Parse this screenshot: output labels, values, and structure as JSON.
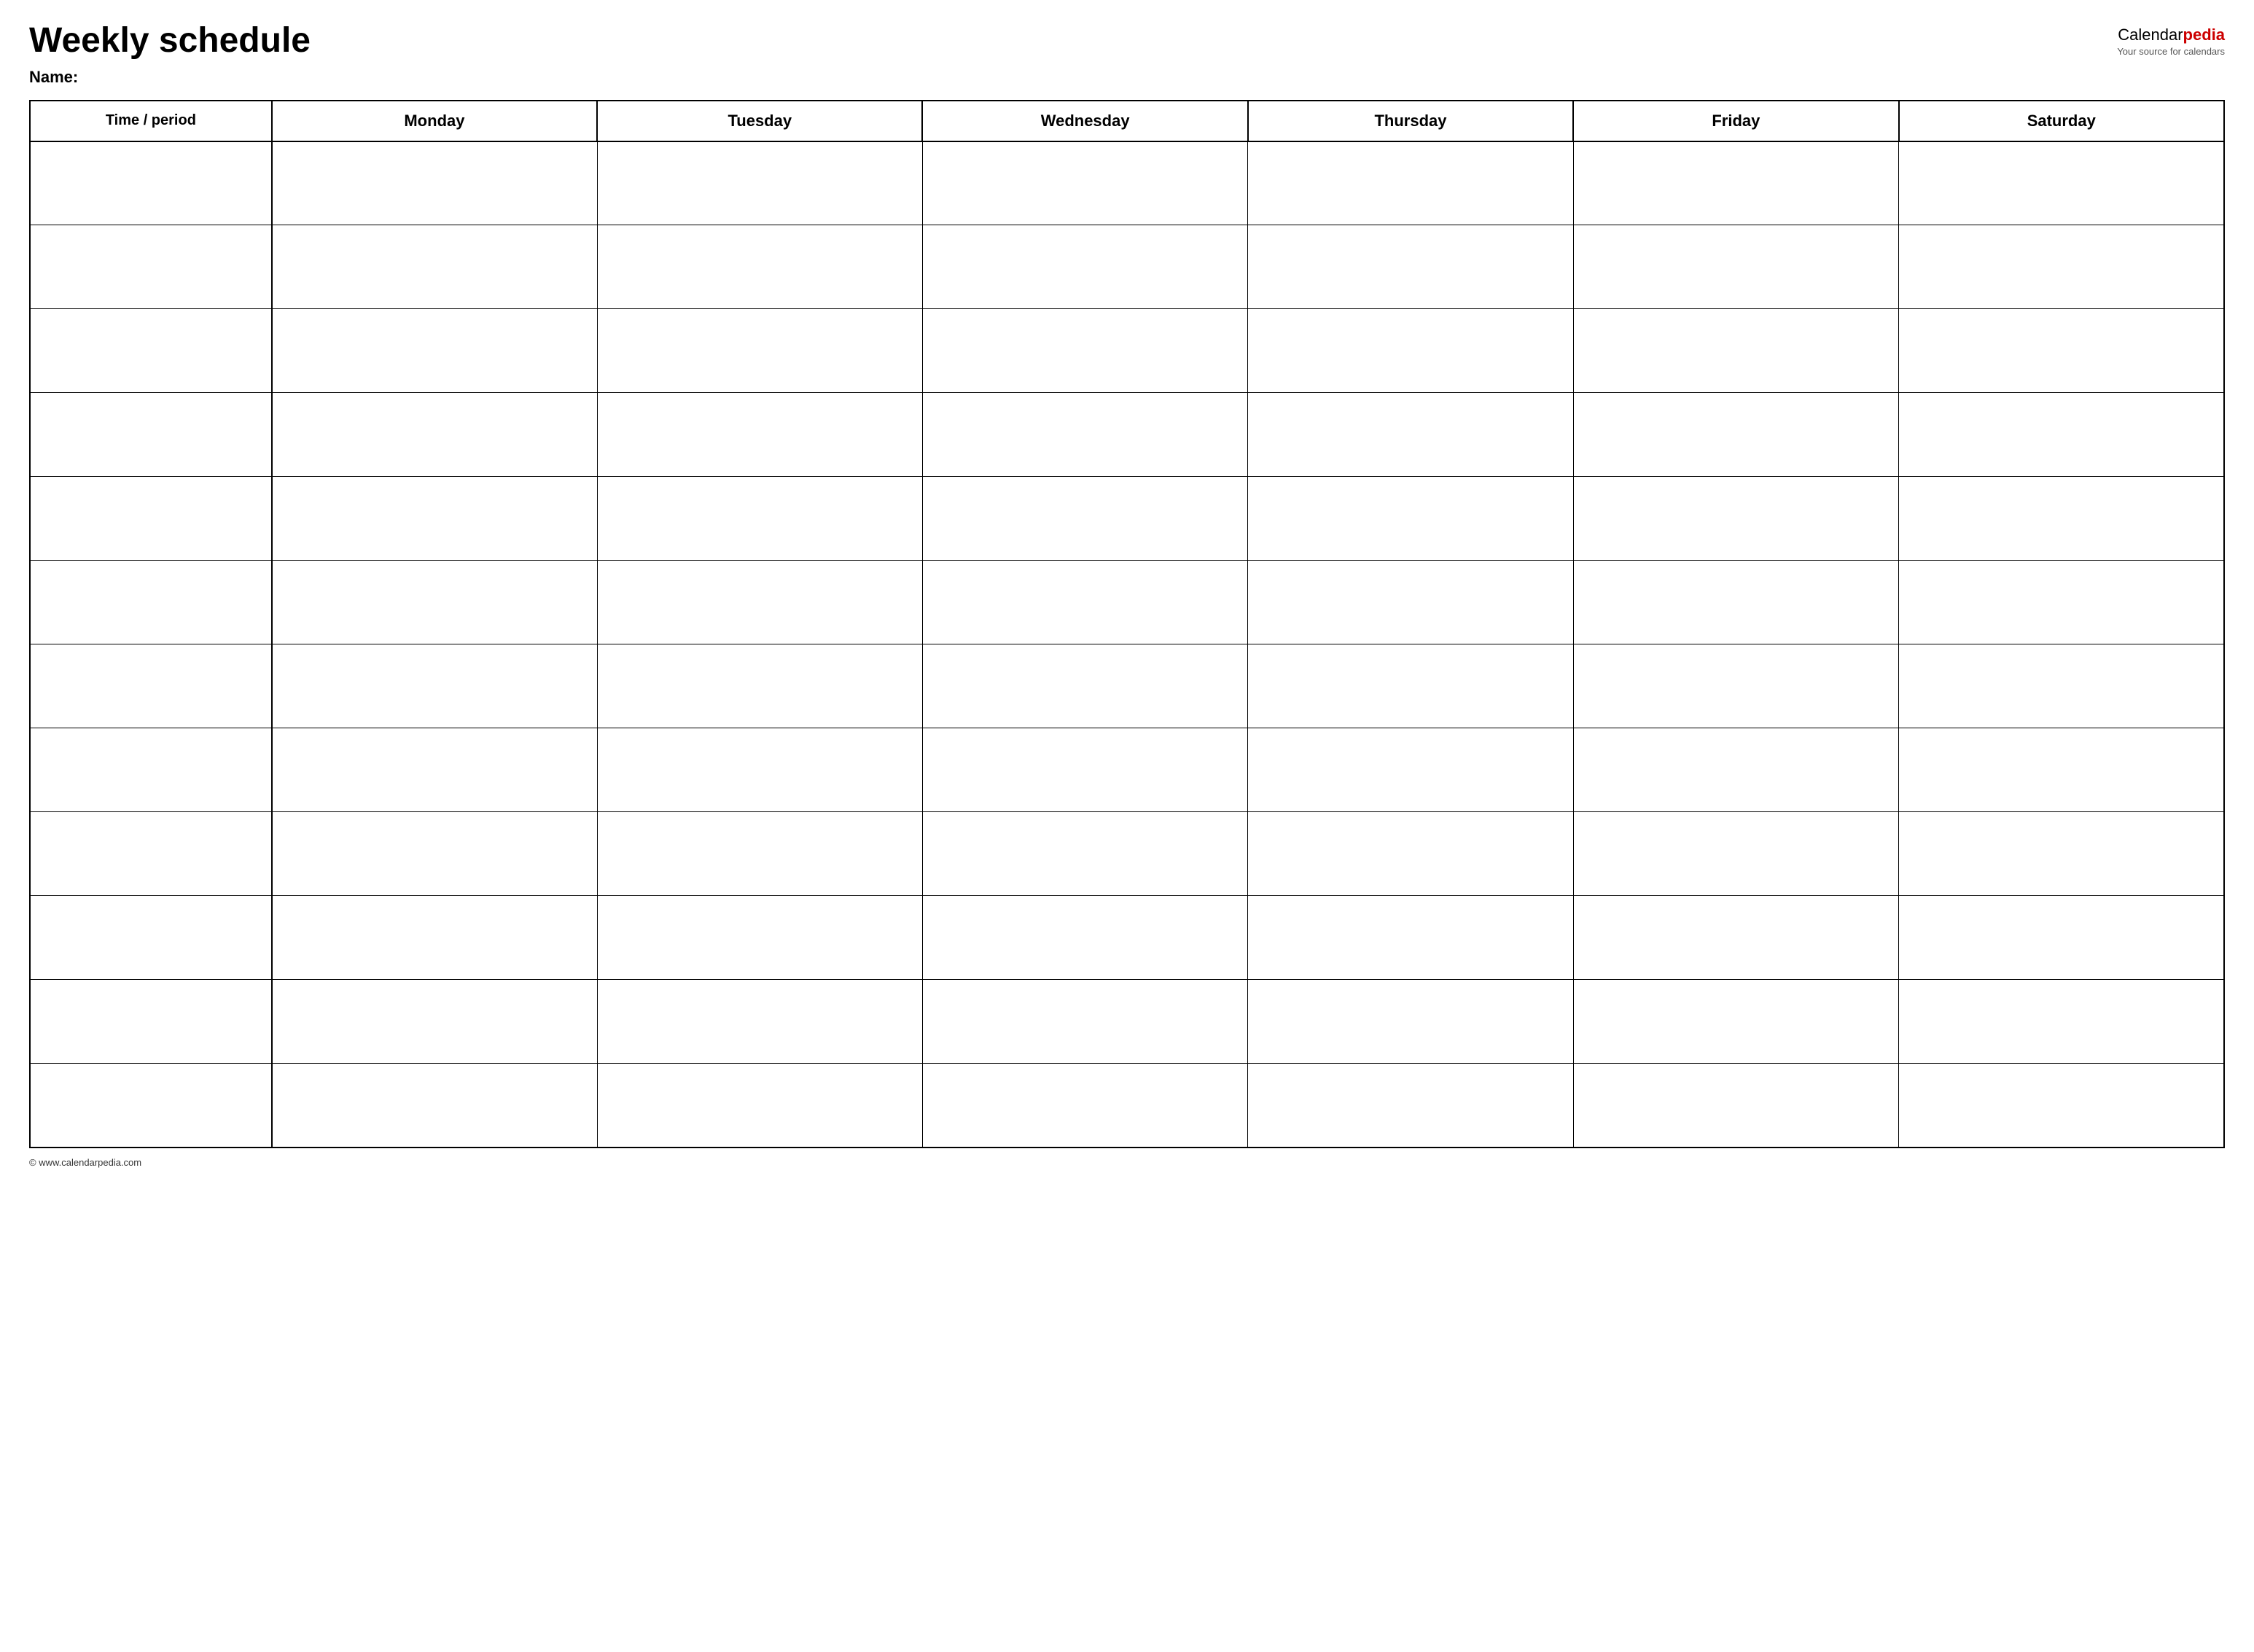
{
  "header": {
    "title": "Weekly schedule",
    "logo_calendar": "Calendar",
    "logo_pedia": "pedia",
    "logo_tagline": "Your source for calendars",
    "name_label": "Name:"
  },
  "table": {
    "columns": [
      {
        "key": "time",
        "label": "Time / period"
      },
      {
        "key": "monday",
        "label": "Monday"
      },
      {
        "key": "tuesday",
        "label": "Tuesday"
      },
      {
        "key": "wednesday",
        "label": "Wednesday"
      },
      {
        "key": "thursday",
        "label": "Thursday"
      },
      {
        "key": "friday",
        "label": "Friday"
      },
      {
        "key": "saturday",
        "label": "Saturday"
      }
    ],
    "row_count": 12
  },
  "footer": {
    "text": "© www.calendarpedia.com"
  }
}
